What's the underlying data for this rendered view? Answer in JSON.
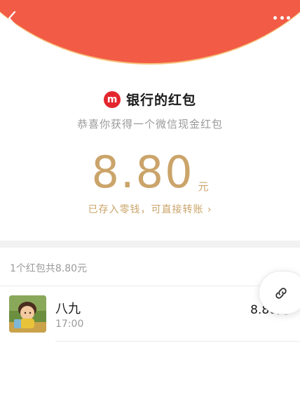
{
  "colors": {
    "header_red": "#f25b46",
    "header_edge": "#f6c27a",
    "gold": "#cba46a",
    "sender_logo": "#e3262e"
  },
  "header": {
    "back_icon": "chevron-left-icon",
    "more_icon": "more-dots-icon"
  },
  "sender": {
    "logo_text": "m",
    "name": "银行的红包",
    "greeting": "恭喜你获得一个微信现金红包"
  },
  "amount": {
    "value": "8.80",
    "unit": "元",
    "stored_text": "已存入零钱，可直接转账 ›"
  },
  "summary": "1个红包共8.80元",
  "records": [
    {
      "name": "八九",
      "time": "17:00",
      "amount": "8.80元"
    }
  ],
  "floating": {
    "icon": "link-icon"
  }
}
